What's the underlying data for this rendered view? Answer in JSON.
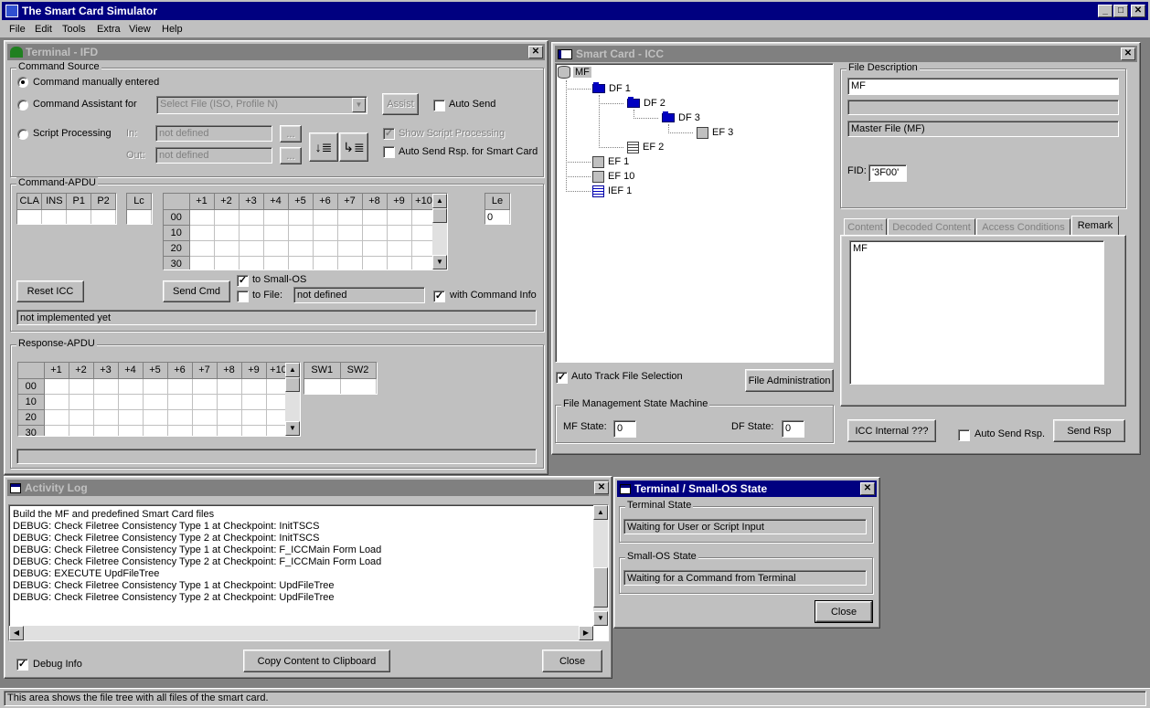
{
  "app": {
    "title": "The Smart Card Simulator"
  },
  "menu": [
    "File",
    "Edit",
    "Tools",
    "Extra",
    "View",
    "Help"
  ],
  "terminal": {
    "title": "Terminal - IFD",
    "command_source": {
      "label": "Command Source",
      "manual": "Command manually entered",
      "assistant": "Command Assistant for",
      "assistant_select": "Select File (ISO, Profile N)",
      "assist_button": "Assist",
      "auto_send": "Auto Send",
      "script": "Script Processing",
      "in_label": "In:",
      "in_value": "not defined",
      "out_label": "Out:",
      "out_value": "not defined",
      "browse": "...",
      "show_script": "Show Script Processing",
      "auto_send_rsp": "Auto Send Rsp. for Smart Card"
    },
    "command_apdu": {
      "label": "Command-APDU",
      "headers": [
        "CLA",
        "INS",
        "P1",
        "P2"
      ],
      "lc": "Lc",
      "le": "Le",
      "le_value": "0",
      "cols": [
        "+1",
        "+2",
        "+3",
        "+4",
        "+5",
        "+6",
        "+7",
        "+8",
        "+9",
        "+10"
      ],
      "rows": [
        "00",
        "10",
        "20",
        "30"
      ],
      "reset_icc": "Reset ICC",
      "send_cmd": "Send Cmd",
      "to_small_os": "to Small-OS",
      "to_file": "to File:",
      "to_file_value": "not defined",
      "with_cmd_info": "with Command Info",
      "status": "not implemented yet"
    },
    "response_apdu": {
      "label": "Response-APDU",
      "cols": [
        "+1",
        "+2",
        "+3",
        "+4",
        "+5",
        "+6",
        "+7",
        "+8",
        "+9",
        "+10"
      ],
      "rows": [
        "00",
        "10",
        "20",
        "30"
      ],
      "sw1": "SW1",
      "sw2": "SW2"
    }
  },
  "icc": {
    "title": "Smart Card - ICC",
    "tree": {
      "mf": "MF",
      "df1": "DF 1",
      "df2": "DF 2",
      "df3": "DF 3",
      "ef3": "EF 3",
      "ef2": "EF 2",
      "ef1": "EF 1",
      "ef10": "EF 10",
      "ief1": "IEF 1"
    },
    "file_description": {
      "label": "File Description",
      "name": "MF",
      "type": "Master File (MF)",
      "fid_label": "FID:",
      "fid": "'3F00'"
    },
    "tabs": [
      "Content",
      "Decoded Content",
      "Access Conditions",
      "Remark"
    ],
    "remark_text": "MF",
    "auto_track": "Auto Track File Selection",
    "file_admin": "File Administration",
    "fsm": {
      "label": "File Management State Machine",
      "mf_label": "MF State:",
      "mf_value": "0",
      "df_label": "DF State:",
      "df_value": "0"
    },
    "icc_internal": "ICC Internal ???",
    "auto_send_rsp": "Auto Send Rsp.",
    "send_rsp": "Send Rsp"
  },
  "activity_log": {
    "title": "Activity Log",
    "lines": [
      "Build the MF and predefined Smart Card files",
      "DEBUG: Check Filetree Consistency Type 1 at Checkpoint: InitTSCS",
      "DEBUG: Check Filetree Consistency Type 2 at Checkpoint: InitTSCS",
      "DEBUG: Check Filetree Consistency Type 1 at Checkpoint: F_ICCMain Form Load",
      "DEBUG: Check Filetree Consistency Type 2 at Checkpoint: F_ICCMain Form Load",
      "DEBUG: EXECUTE UpdFileTree",
      "DEBUG: Check Filetree Consistency Type 1 at Checkpoint: UpdFileTree",
      "DEBUG: Check Filetree Consistency Type 2 at Checkpoint: UpdFileTree"
    ],
    "debug_info": "Debug Info",
    "copy": "Copy Content to Clipboard",
    "close": "Close"
  },
  "state": {
    "title": "Terminal / Small-OS State",
    "terminal_label": "Terminal State",
    "terminal_value": "Waiting for User or Script Input",
    "os_label": "Small-OS State",
    "os_value": "Waiting for a Command from Terminal",
    "close": "Close"
  },
  "statusbar": "This area shows the file tree with all files of the smart card.",
  "icons": {
    "checked": "✓",
    "close": "✕",
    "minimize": "_",
    "maximize": "□"
  },
  "colors": {
    "active_title": "#000080",
    "inactive_title": "#808080",
    "face": "#c0c0c0",
    "desktop": "#808080"
  }
}
